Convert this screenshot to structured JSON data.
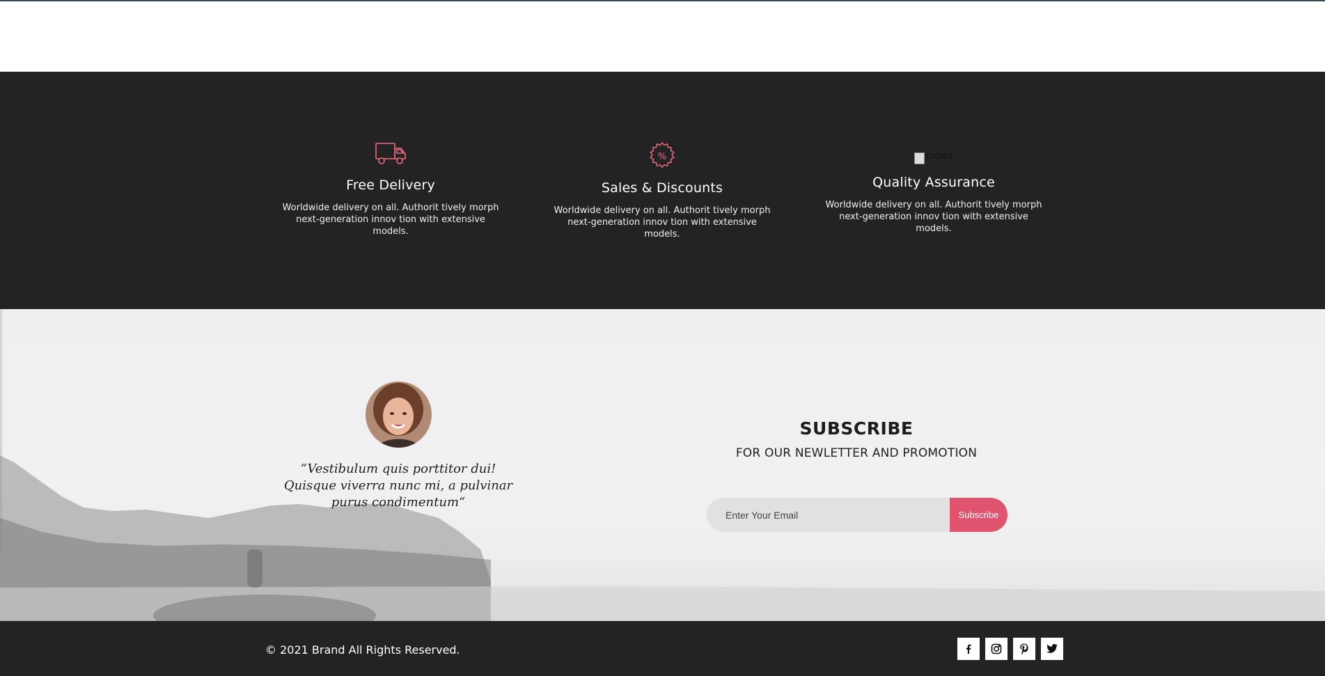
{
  "features": [
    {
      "icon": "delivery-truck-icon",
      "title": "Free Delivery",
      "description": "Worldwide delivery on all. Authorit tively morph next-generation innov tion with extensive models."
    },
    {
      "icon": "discount-badge-icon",
      "title": "Sales & Discounts",
      "description": "Worldwide delivery on all. Authorit tively morph next-generation innov tion with extensive models."
    },
    {
      "icon": "crown-icon",
      "icon_alt": "crown",
      "title": "Quality Assurance",
      "description": "Worldwide delivery on all. Authorit tively morph next-generation innov tion with extensive models."
    }
  ],
  "testimonial": {
    "quote": "“Vestibulum quis porttitor dui! Quisque viverra nunc mi, a pulvinar purus condimentum“"
  },
  "subscribe": {
    "title": "SUBSCRIBE",
    "subtitle": "FOR OUR NEWLETTER AND PROMOTION",
    "email_placeholder": "Enter Your Email",
    "button_label": "Subscribe"
  },
  "footer": {
    "copyright": "© 2021 Brand All Rights Reserved.",
    "social": [
      "facebook-icon",
      "instagram-icon",
      "pinterest-icon",
      "twitter-icon"
    ]
  },
  "colors": {
    "accent": "#e0546f",
    "dark_bg": "#232323",
    "icon_stroke": "#f06b80"
  }
}
